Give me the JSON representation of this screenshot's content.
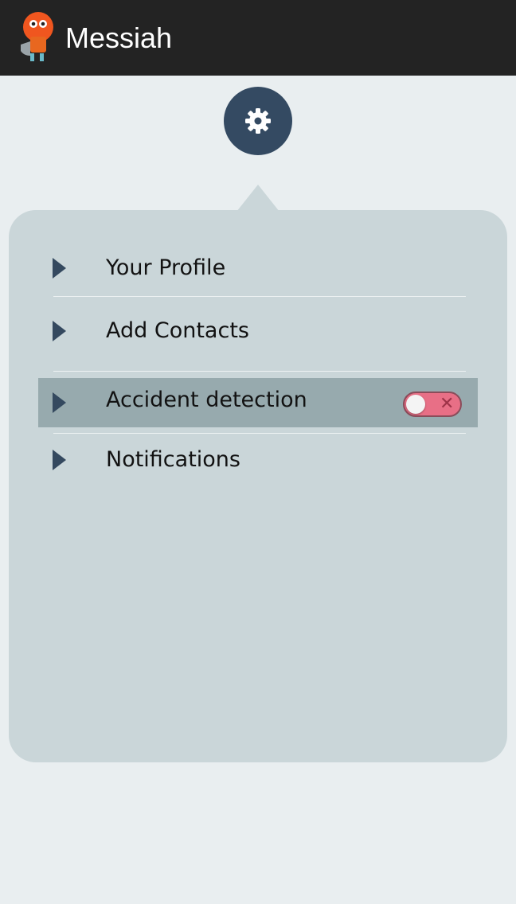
{
  "appbar": {
    "title": "Messiah",
    "logo_icon": "messiah-mascot-logo-icon",
    "background": "#232323"
  },
  "settings_button": {
    "icon": "gear-icon",
    "color": "#344a62"
  },
  "menu": {
    "items": [
      {
        "label": "Your Profile",
        "icon": "caret-right-icon",
        "active": false
      },
      {
        "label": "Add Contacts",
        "icon": "caret-right-icon",
        "active": false
      },
      {
        "label": "Accident detection",
        "icon": "caret-right-icon",
        "active": true,
        "toggle": {
          "state": "off",
          "icon": "close-icon",
          "color": "#e86f86"
        }
      },
      {
        "label": "Notifications",
        "icon": "caret-right-icon",
        "active": false
      }
    ]
  },
  "colors": {
    "panel": "#cad6d9",
    "active_row": "#97aaae",
    "page_background": "#e9eef0"
  }
}
